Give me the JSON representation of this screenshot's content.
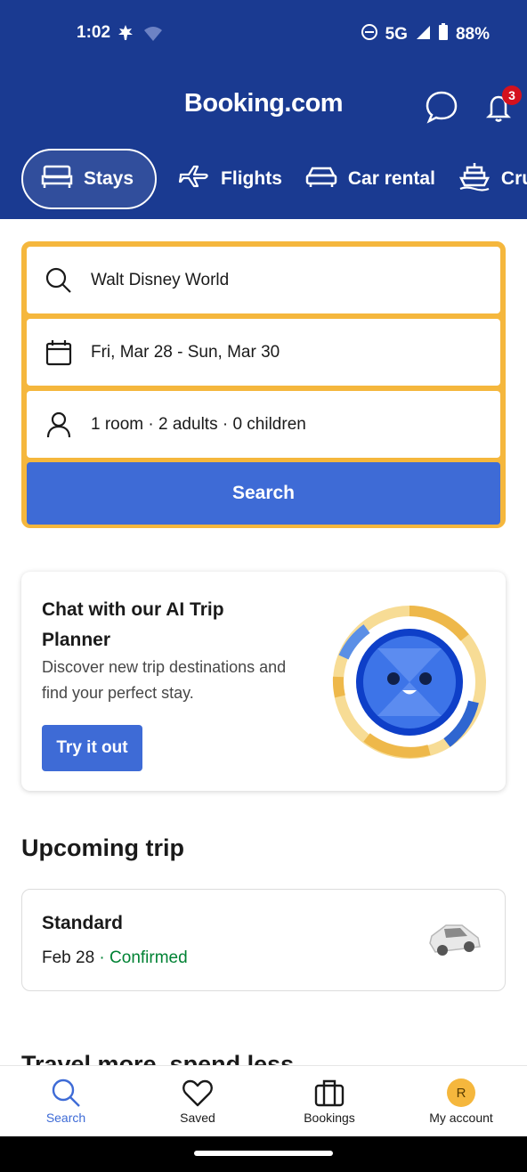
{
  "status_bar": {
    "time": "1:02",
    "network": "5G",
    "battery": "88%"
  },
  "header": {
    "brand": "Booking.com",
    "notification_count": "3"
  },
  "tabs": [
    {
      "label": "Stays",
      "icon": "bed-icon",
      "active": true
    },
    {
      "label": "Flights",
      "icon": "plane-icon"
    },
    {
      "label": "Car rental",
      "icon": "car-icon"
    },
    {
      "label": "Cru",
      "icon": "cruise-icon"
    }
  ],
  "search": {
    "destination": "Walt Disney World",
    "dates": "Fri, Mar 28 - Sun, Mar 30",
    "guests": "1 room · 2 adults · 0 children",
    "button_label": "Search"
  },
  "ai_card": {
    "title": "Chat with our AI Trip Planner",
    "description": "Discover new trip destinations and find your perfect stay.",
    "button_label": "Try it out"
  },
  "upcoming": {
    "section_title": "Upcoming trip",
    "trip_name": "Standard",
    "trip_date": "Feb 28",
    "separator": " · ",
    "trip_status": "Confirmed"
  },
  "next_section_peek": "Travel more, spend less",
  "bottom_nav": [
    {
      "label": "Search",
      "icon": "search-icon",
      "active": true
    },
    {
      "label": "Saved",
      "icon": "heart-icon"
    },
    {
      "label": "Bookings",
      "icon": "briefcase-icon"
    },
    {
      "label": "My account",
      "icon": "avatar",
      "initial": "R"
    }
  ],
  "colors": {
    "brand_blue": "#1a3a91",
    "action_blue": "#3e6bd6",
    "accent_yellow": "#f5b73d",
    "confirmed_green": "#008234"
  }
}
